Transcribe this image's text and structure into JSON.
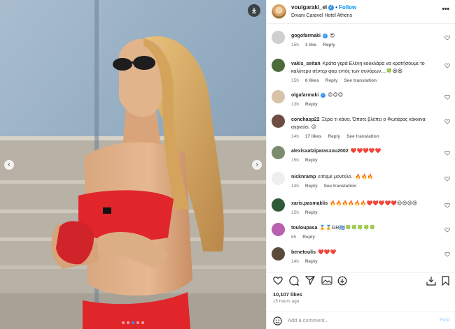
{
  "post": {
    "username": "voulgaraki_el",
    "follow_label": "Follow",
    "separator": "•",
    "location": "Divani Caravel Hotel Athens",
    "likes": "10,107 likes",
    "time": "15 hours ago",
    "add_comment_placeholder": "Add a comment...",
    "post_label": "Post"
  },
  "comments": [
    {
      "user": "gogofarmaki",
      "verified": true,
      "text": "😍",
      "time": "15h",
      "likes": "1 like",
      "reply": "Reply",
      "translate": "",
      "avatar_color": "#cfcfcf"
    },
    {
      "user": "vakis_seitan",
      "verified": false,
      "text": "Κράτα γερά Ελένη κουκλάρα να κρατήσουμε το καλύτερο σέντερ φορ εντός των συνόρων....🍀😆😆",
      "time": "15h",
      "likes": "6 likes",
      "reply": "Reply",
      "translate": "See translation",
      "avatar_color": "#4b6b3a"
    },
    {
      "user": "olgafarmaki",
      "verified": true,
      "text": "😍😍😍",
      "time": "13h",
      "likes": "",
      "reply": "Reply",
      "translate": "",
      "avatar_color": "#d8c2a8"
    },
    {
      "user": "conchasp22",
      "verified": false,
      "text": "Ξέρει τι κάνει. Όποτε βλέπει ο Φωτάρας κόκκινα αγριεύει. 😉",
      "time": "14h",
      "likes": "17 likes",
      "reply": "Reply",
      "translate": "See translation",
      "avatar_color": "#6d4c41"
    },
    {
      "user": "alexisxatziparasxou2002",
      "verified": false,
      "text": "❤️❤️❤️❤️❤️",
      "time": "15h",
      "likes": "",
      "reply": "Reply",
      "translate": "",
      "avatar_color": "#7c8a6e"
    },
    {
      "user": "nicknramp",
      "verified": false,
      "text": "ειπαμε μοντελο.. 🔥🔥🔥",
      "time": "14h",
      "likes": "",
      "reply": "Reply",
      "translate": "See translation",
      "avatar_color": "#eeeeee"
    },
    {
      "user": "xaris.pasmaklis",
      "verified": false,
      "text": "🔥🔥🔥🔥🔥🔥❤️❤️❤️❤️❤️😍😍😍😍",
      "time": "15h",
      "likes": "",
      "reply": "Reply",
      "translate": "",
      "avatar_color": "#2e5a3a"
    },
    {
      "user": "touloupasa",
      "verified": false,
      "text": "🏅🏅GR🇬🇷🍀🍀🍀🍀🍀",
      "time": "6h",
      "likes": "",
      "reply": "Reply",
      "translate": "",
      "avatar_color": "#b95fb0"
    },
    {
      "user": "benetoulis",
      "verified": false,
      "text": "❤️❤️❤️",
      "time": "14h",
      "likes": "",
      "reply": "Reply",
      "translate": "",
      "avatar_color": "#5a4a3c"
    }
  ],
  "icons": {
    "download": "download-icon",
    "more": "more-options-icon",
    "heart": "heart-icon",
    "comment": "comment-icon",
    "share": "share-icon",
    "gallery": "gallery-icon",
    "remix": "remix-icon",
    "bookmark": "bookmark-icon",
    "smile": "emoji-icon"
  },
  "colors": {
    "accent": "#0095f6",
    "post_disabled": "#b3dbff",
    "verified": "#3897f0"
  }
}
